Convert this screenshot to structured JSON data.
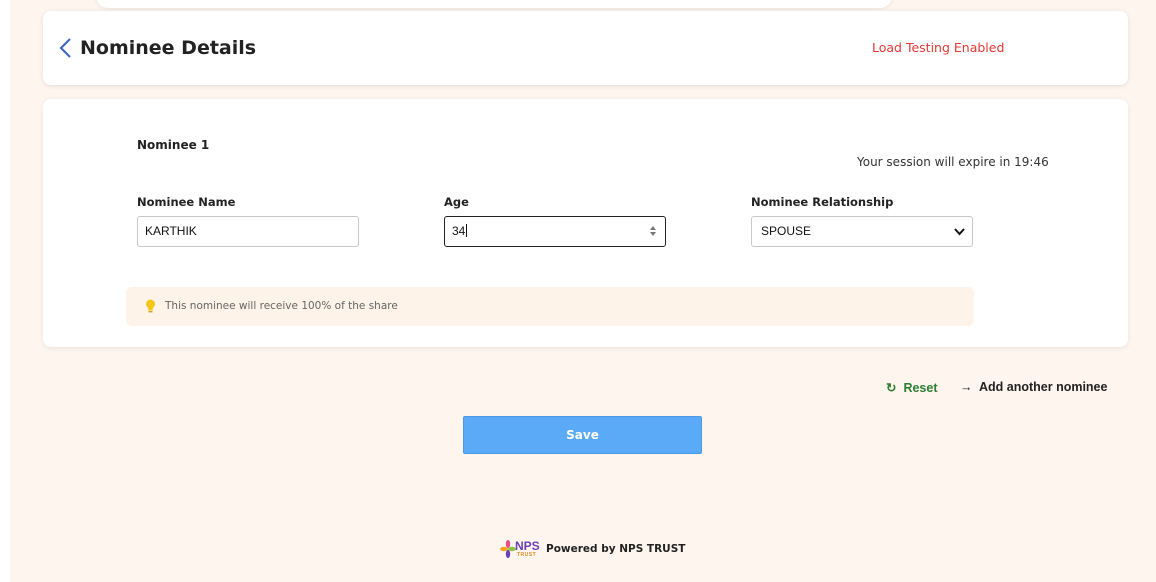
{
  "header": {
    "title": "Nominee Details",
    "status_text": "Load Testing Enabled",
    "back_icon": "chevron-left-icon"
  },
  "form": {
    "nominee_heading": "Nominee 1",
    "session_text": "Your session will expire in 19:46",
    "fields": {
      "name": {
        "label": "Nominee Name",
        "value": "KARTHIK"
      },
      "age": {
        "label": "Age",
        "value": "34"
      },
      "relationship": {
        "label": "Nominee Relationship",
        "value": "SPOUSE"
      }
    },
    "info": {
      "icon": "lightbulb-icon",
      "text": "This nominee will receive 100% of the share"
    }
  },
  "actions": {
    "reset_label": "Reset",
    "reset_icon": "↻",
    "add_label": "Add another nominee",
    "add_icon": "→",
    "save_label": "Save"
  },
  "footer": {
    "logo_text": "NPS",
    "logo_subtext": "TRUST",
    "powered_text": "Powered by NPS TRUST"
  },
  "colors": {
    "page_background": "#fdf5ee",
    "alert_red": "#e53935",
    "reset_green": "#2e7d32",
    "save_blue": "#5aaaf7"
  }
}
